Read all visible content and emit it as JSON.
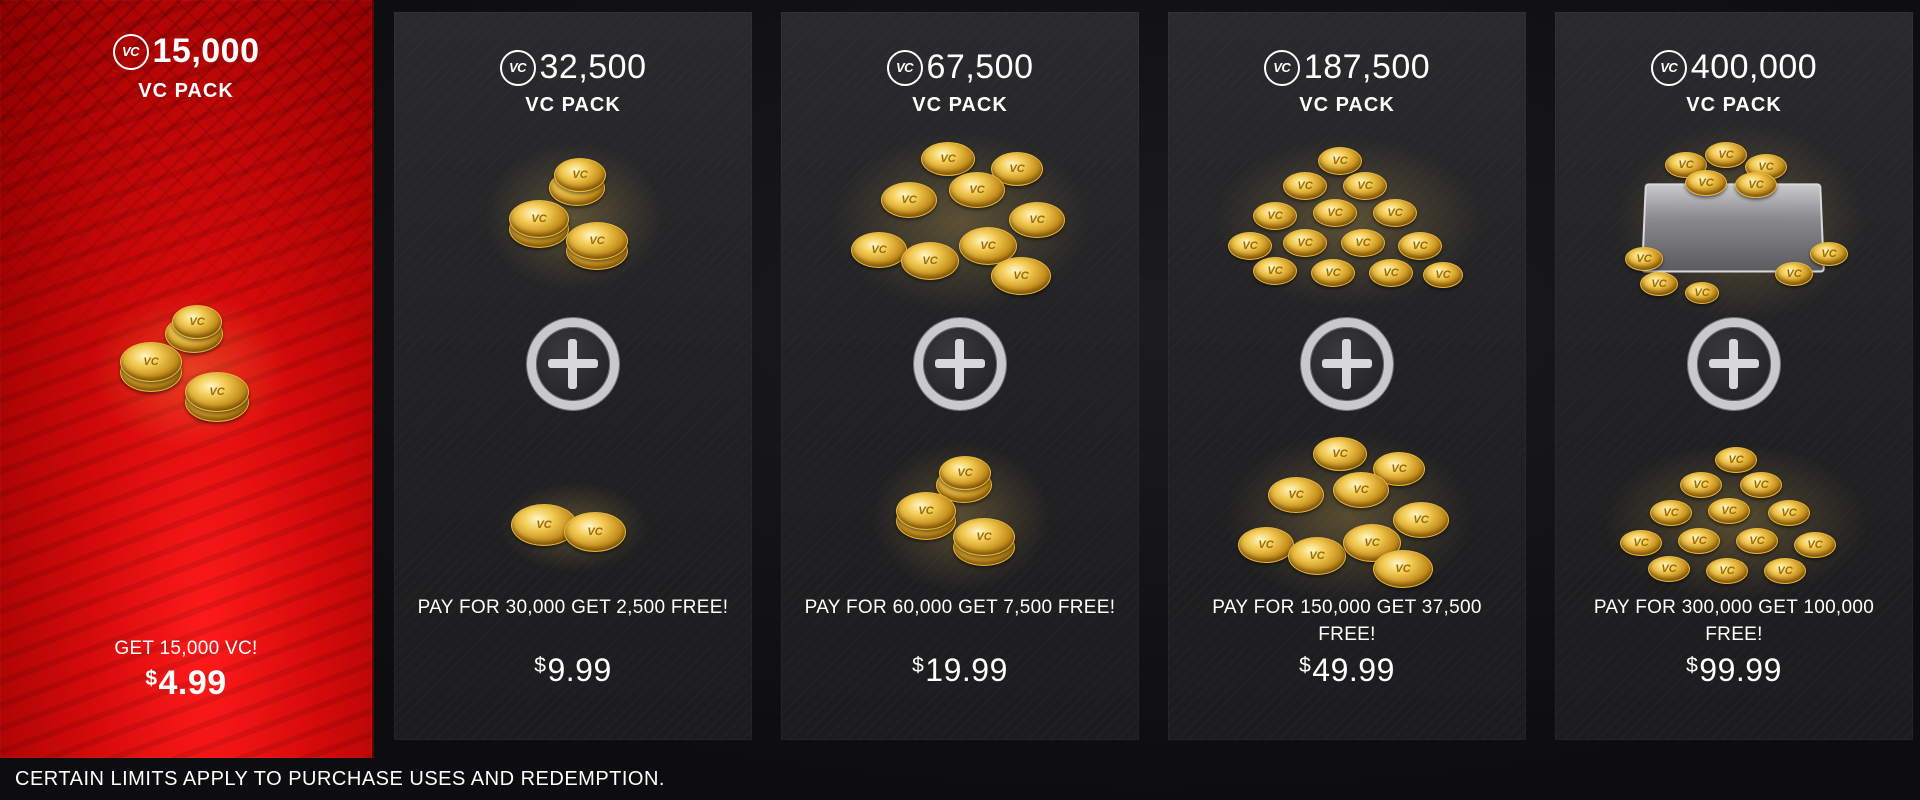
{
  "packs": [
    {
      "amount": "15,000",
      "label": "VC PACK",
      "offer": "GET 15,000 VC!",
      "price": "4.99"
    },
    {
      "amount": "32,500",
      "label": "VC PACK",
      "offer": "PAY FOR 30,000 GET 2,500 FREE!",
      "price": "9.99"
    },
    {
      "amount": "67,500",
      "label": "VC PACK",
      "offer": "PAY FOR 60,000 GET 7,500 FREE!",
      "price": "19.99"
    },
    {
      "amount": "187,500",
      "label": "VC PACK",
      "offer": "PAY FOR 150,000 GET 37,500 FREE!",
      "price": "49.99"
    },
    {
      "amount": "400,000",
      "label": "VC PACK",
      "offer": "PAY FOR 300,000 GET 100,000 FREE!",
      "price": "99.99"
    }
  ],
  "vc_badge": "VC",
  "currency_symbol": "$",
  "disclaimer": "CERTAIN LIMITS APPLY TO PURCHASE USES AND REDEMPTION.",
  "colors": {
    "featured_red": "#e00a0a",
    "card_dark": "#242426",
    "coin_gold": "#e0b23c"
  }
}
